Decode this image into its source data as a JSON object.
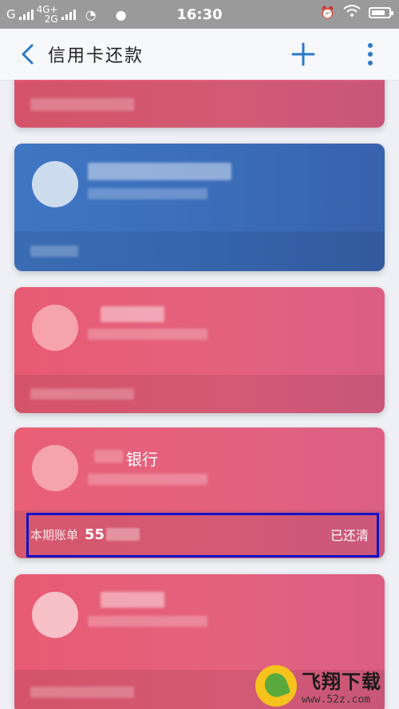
{
  "status_bar": {
    "network1": "G",
    "network2_top": "4G+",
    "network2_bottom": "2G",
    "time": "16:30",
    "battery_level": 0.8
  },
  "app_bar": {
    "title": "信用卡还款",
    "back_icon": "chevron-left-icon",
    "add_icon": "plus-icon",
    "more_icon": "more-vertical-icon"
  },
  "cards": [
    {
      "color": "#e85b72",
      "bank_name": "",
      "bill_label": "",
      "bill_amount": "",
      "status": ""
    },
    {
      "color": "#3f76c4",
      "bank_name": "",
      "bill_label": "",
      "bill_amount": "",
      "status": ""
    },
    {
      "color": "#e85b72",
      "bank_name": "",
      "bill_label": "",
      "bill_amount": "",
      "status": ""
    },
    {
      "color": "#e4627f",
      "bank_name": "银行",
      "bill_label": "本期账单",
      "bill_amount": "55",
      "status": "已还清"
    },
    {
      "color": "#e85b72",
      "bank_name": "",
      "bill_label": "",
      "bill_amount": "",
      "status": ""
    }
  ],
  "watermark": {
    "brand": "飞翔下载",
    "url": "www.52z.com"
  }
}
